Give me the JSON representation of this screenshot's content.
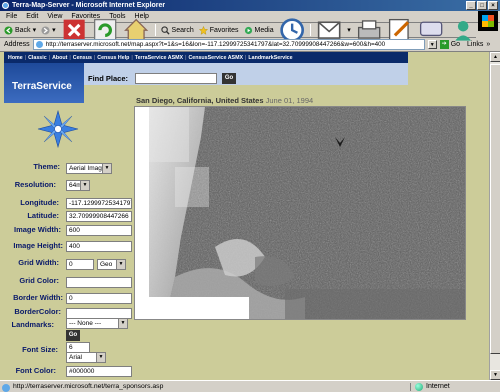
{
  "window": {
    "title": "Terra-Map-Server - Microsoft Internet Explorer",
    "controls": [
      "_",
      "□",
      "×"
    ]
  },
  "menu": [
    "File",
    "Edit",
    "View",
    "Favorites",
    "Tools",
    "Help"
  ],
  "toolbar": {
    "back": "Back",
    "search": "Search",
    "favorites": "Favorites",
    "media": "Media"
  },
  "address": {
    "label": "Address",
    "url": "http://terraserver.microsoft.net/map.aspx?t=1&s=16&lon=-117.12999725341797&lat=32.70999908447266&w=600&h=400",
    "go": "Go",
    "links": "Links"
  },
  "site": {
    "nav": [
      "Home",
      "Classic",
      "About",
      "Census",
      "Census Help",
      "TerraService ASMX",
      "CensusService ASMX",
      "LandmarkService"
    ],
    "brand": "TerraService",
    "find_place_label": "Find Place:",
    "find_place_value": "",
    "find_go": "Go"
  },
  "map": {
    "place": "San Diego, California, United States",
    "date": "June 01, 1994"
  },
  "form": {
    "theme_label": "Theme:",
    "theme_value": "Aerial Image",
    "resolution_label": "Resolution:",
    "resolution_value": "64m",
    "longitude_label": "Longitude:",
    "longitude_value": "-117.12999725341797",
    "latitude_label": "Latitude:",
    "latitude_value": "32.70999908447266",
    "width_label": "Image Width:",
    "width_value": "600",
    "height_label": "Image Height:",
    "height_value": "400",
    "gridwidth_label": "Grid Width:",
    "gridwidth_value": "0",
    "gridunit_value": "Geo",
    "gridcolor_label": "Grid Color:",
    "gridcolor_value": "",
    "borderwidth_label": "Border Width:",
    "borderwidth_value": "0",
    "bordercolor_label": "BorderColor:",
    "bordercolor_value": "",
    "landmarks_label": "Landmarks:",
    "landmarks_value": "--- None ---",
    "landmarks_go": "Go",
    "fontsize_label": "Font Size:",
    "fontsize_value": "6",
    "fontname_value": "Arial",
    "fontcolor_label": "Font Color:",
    "fontcolor_value": "#000000"
  },
  "status": {
    "text": "http://terraserver.microsoft.net/terra_sponsors.asp",
    "zone": "Internet"
  }
}
